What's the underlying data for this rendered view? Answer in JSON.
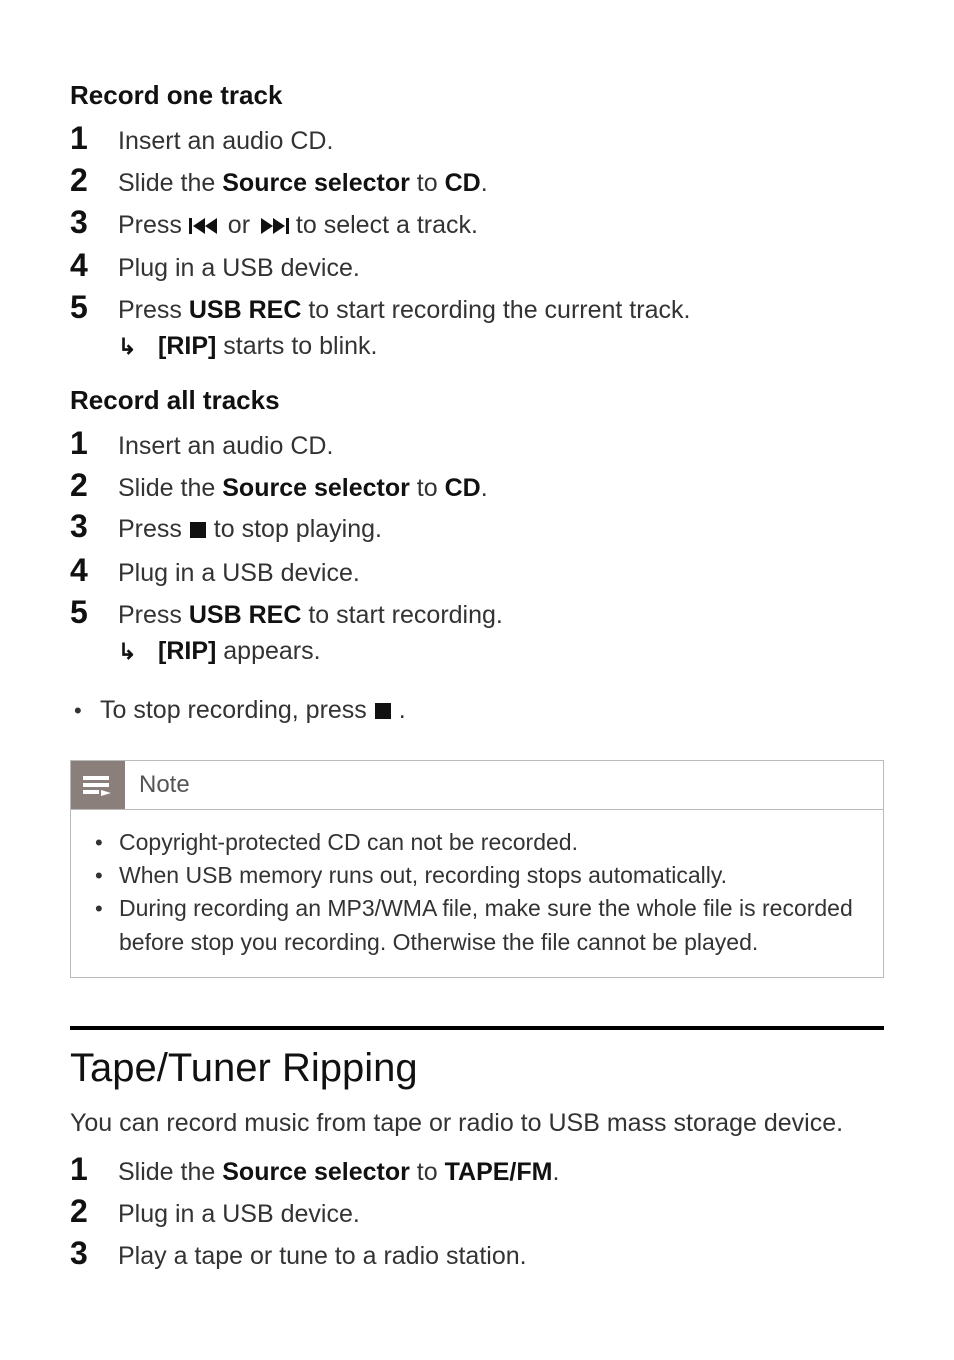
{
  "section1": {
    "heading": "Record one track",
    "steps": [
      {
        "n": "1",
        "parts": [
          {
            "t": "Insert an audio CD."
          }
        ]
      },
      {
        "n": "2",
        "parts": [
          {
            "t": "Slide the "
          },
          {
            "t": "Source selector",
            "b": true
          },
          {
            "t": " to  "
          },
          {
            "t": "CD",
            "b": true
          },
          {
            "t": "."
          }
        ]
      },
      {
        "n": "3",
        "parts": [
          {
            "t": "Press "
          },
          {
            "icon": "prev"
          },
          {
            "t": " or "
          },
          {
            "icon": "next"
          },
          {
            "t": "  to select a track."
          }
        ]
      },
      {
        "n": "4",
        "parts": [
          {
            "t": "Plug in a USB device."
          }
        ]
      },
      {
        "n": "5",
        "parts": [
          {
            "t": "Press "
          },
          {
            "t": "USB REC",
            "b": true
          },
          {
            "t": " to start recording the current track."
          }
        ],
        "result": [
          {
            "t": "[RIP]",
            "b": true
          },
          {
            "t": " starts to blink."
          }
        ]
      }
    ]
  },
  "section2": {
    "heading": "Record all tracks",
    "steps": [
      {
        "n": "1",
        "parts": [
          {
            "t": "Insert an audio CD."
          }
        ]
      },
      {
        "n": "2",
        "parts": [
          {
            "t": "Slide the "
          },
          {
            "t": "Source selector",
            "b": true
          },
          {
            "t": " to  "
          },
          {
            "t": "CD",
            "b": true
          },
          {
            "t": "."
          }
        ]
      },
      {
        "n": "3",
        "parts": [
          {
            "t": "Press  "
          },
          {
            "icon": "stop"
          },
          {
            "t": "  to stop playing."
          }
        ]
      },
      {
        "n": "4",
        "parts": [
          {
            "t": "Plug in a USB device."
          }
        ]
      },
      {
        "n": "5",
        "parts": [
          {
            "t": "Press "
          },
          {
            "t": "USB REC",
            "b": true
          },
          {
            "t": " to start recording."
          }
        ],
        "result": [
          {
            "t": "[RIP]",
            "b": true
          },
          {
            "t": " appears."
          }
        ]
      }
    ],
    "tail_bullet": [
      {
        "t": "To stop recording, press  "
      },
      {
        "icon": "stop"
      },
      {
        "t": " ."
      }
    ]
  },
  "note": {
    "label": "Note",
    "items": [
      "Copyright-protected CD can not be recorded.",
      "When USB memory runs out, recording stops automatically.",
      "During recording an MP3/WMA file, make sure the whole file is recorded before stop you recording. Otherwise the file cannot be played."
    ]
  },
  "section3": {
    "heading": "Tape/Tuner Ripping",
    "intro": "You can record music from tape or radio to USB mass storage device.",
    "steps": [
      {
        "n": "1",
        "parts": [
          {
            "t": "Slide the "
          },
          {
            "t": "Source selector",
            "b": true
          },
          {
            "t": " to "
          },
          {
            "t": "TAPE/FM",
            "b": true
          },
          {
            "t": "."
          }
        ]
      },
      {
        "n": "2",
        "parts": [
          {
            "t": "Plug in a USB device."
          }
        ]
      },
      {
        "n": "3",
        "parts": [
          {
            "t": "Play a tape or tune to a radio station."
          }
        ]
      }
    ]
  },
  "icons": {
    "prev": "skip-previous-icon",
    "next": "skip-next-icon",
    "stop": "stop-icon",
    "result_arrow": "↳",
    "note": "note-lines-icon"
  }
}
